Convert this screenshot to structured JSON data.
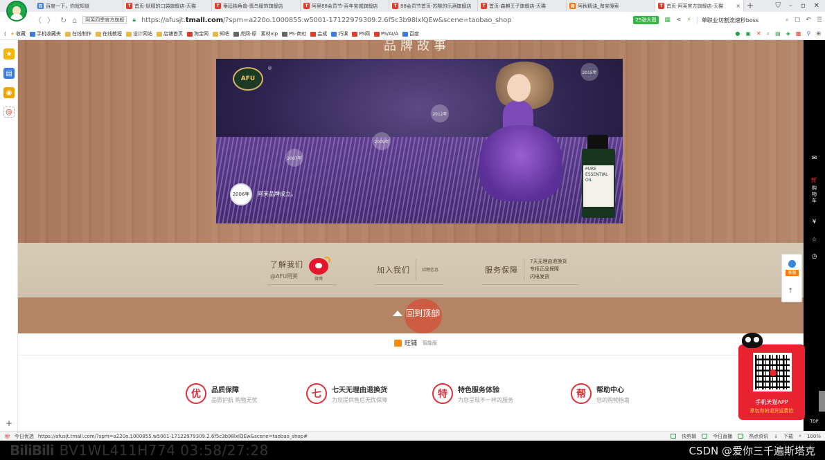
{
  "tabs": [
    {
      "title": "百度一下，你就知道",
      "color": "#3a7ce0",
      "glyph": "百",
      "active": false
    },
    {
      "title": "首页-妖精的口袋旗舰店-天猫",
      "color": "#e03c2d",
      "glyph": "T",
      "active": false
    },
    {
      "title": "蒂廷独角兽-翡鸟服饰旗舰店",
      "color": "#e03c2d",
      "glyph": "T",
      "active": false
    },
    {
      "title": "阿里88会员节-百年宝城旗舰店",
      "color": "#e03c2d",
      "glyph": "T",
      "active": false
    },
    {
      "title": "88会员节首页-苏酸的乐酒旗舰店",
      "color": "#e03c2d",
      "glyph": "T",
      "active": false
    },
    {
      "title": "首页-森麒王子旗舰店-天猫",
      "color": "#e03c2d",
      "glyph": "T",
      "active": false
    },
    {
      "title": "阿秋精油_淘宝搜索",
      "color": "#ff6a00",
      "glyph": "淘",
      "active": false
    },
    {
      "title": "首页-阿芙官方旗舰店-天猫",
      "color": "#e03c2d",
      "glyph": "T",
      "active": true
    }
  ],
  "address": {
    "site_badge": "阿芙四季官方旗舰",
    "url_prefix": "https://afusjt.",
    "url_host": "tmall.com",
    "url_rest": "/?spm=a220o.1000855.w5001-17122979309.2.6f5c3b98lxlQEw&scene=taobao_shop",
    "zoom_label": "25张大图",
    "search_text": "单职业切割流速秒boss"
  },
  "bookmarks": [
    {
      "label": "收藏",
      "icon": "star"
    },
    {
      "label": "手机收藏夹",
      "icon": "folder"
    },
    {
      "label": "在线制作",
      "icon": "folder"
    },
    {
      "label": "在线教程",
      "icon": "folder"
    },
    {
      "label": "设计网站",
      "icon": "folder"
    },
    {
      "label": "店铺首页",
      "icon": "folder"
    },
    {
      "label": "淘宝网",
      "icon": "red"
    },
    {
      "label": "知吧",
      "icon": "folder"
    },
    {
      "label": "虎网-原",
      "icon": "gray"
    },
    {
      "label": "素材vip",
      "icon": "none"
    },
    {
      "label": "PS-商虹",
      "icon": "gray"
    },
    {
      "label": "会成",
      "icon": "red"
    },
    {
      "label": "巧课",
      "icon": "blue"
    },
    {
      "label": "PS网",
      "icon": "red"
    },
    {
      "label": "PS/AI/A",
      "icon": "red"
    },
    {
      "label": "百度",
      "icon": "blue"
    }
  ],
  "hero": {
    "heading": "品牌故事",
    "logo_text": "AFU",
    "registered": "®",
    "year_main": "2006年",
    "year_caption": "阿芙品牌成立。",
    "years_faded": [
      "2015年",
      "2012年",
      "2009年",
      "2007年"
    ],
    "bottle_label": "PURE ESSENTIAL OIL"
  },
  "info_band": {
    "about": {
      "title": "了解我们",
      "sub": "@AFU阿芙",
      "icon_label": "微博"
    },
    "join": {
      "title": "加入我们",
      "sub": "招聘信息"
    },
    "service": {
      "title": "服务保障",
      "items": [
        "7天无理由退换货",
        "专柜正品保障",
        "闪电发货"
      ]
    }
  },
  "back_to_top": {
    "label": "回到顶部"
  },
  "wangpu": {
    "name": "旺铺",
    "sub": "智能版"
  },
  "guarantees": [
    {
      "glyph": "优",
      "title": "品质保障",
      "sub": "品质护航 购物无忧"
    },
    {
      "glyph": "七",
      "title": "七天无理由退换货",
      "sub": "为您提供售后无忧保障"
    },
    {
      "glyph": "特",
      "title": "特色服务体验",
      "sub": "为您呈现不一样的服务"
    },
    {
      "glyph": "帮",
      "title": "帮助中心",
      "sub": "您的购物指南"
    }
  ],
  "right_bar": {
    "cart": "购物车",
    "kefu": "客服",
    "app_title": "手机天猫APP",
    "app_sub": "承包你的退货运费险",
    "tmall_badge": "天猫",
    "top": "TOP"
  },
  "status": {
    "left_label": "今日优选",
    "url": "https://afusjt.tmall.com/?spm=a220o.1000855.w5001-17122979309.2.6f5c3b98lxlQEw&scene=taobao_shop#",
    "items": [
      "快剪辑",
      "今日直播",
      "热点资讯",
      "下载"
    ],
    "zoom": "100%"
  },
  "video_overlay": {
    "bili": "BiliBili",
    "code": "BV1WL411H774 03:58/27:28",
    "watermark": "CSDN @爱你三千遍斯塔克"
  }
}
